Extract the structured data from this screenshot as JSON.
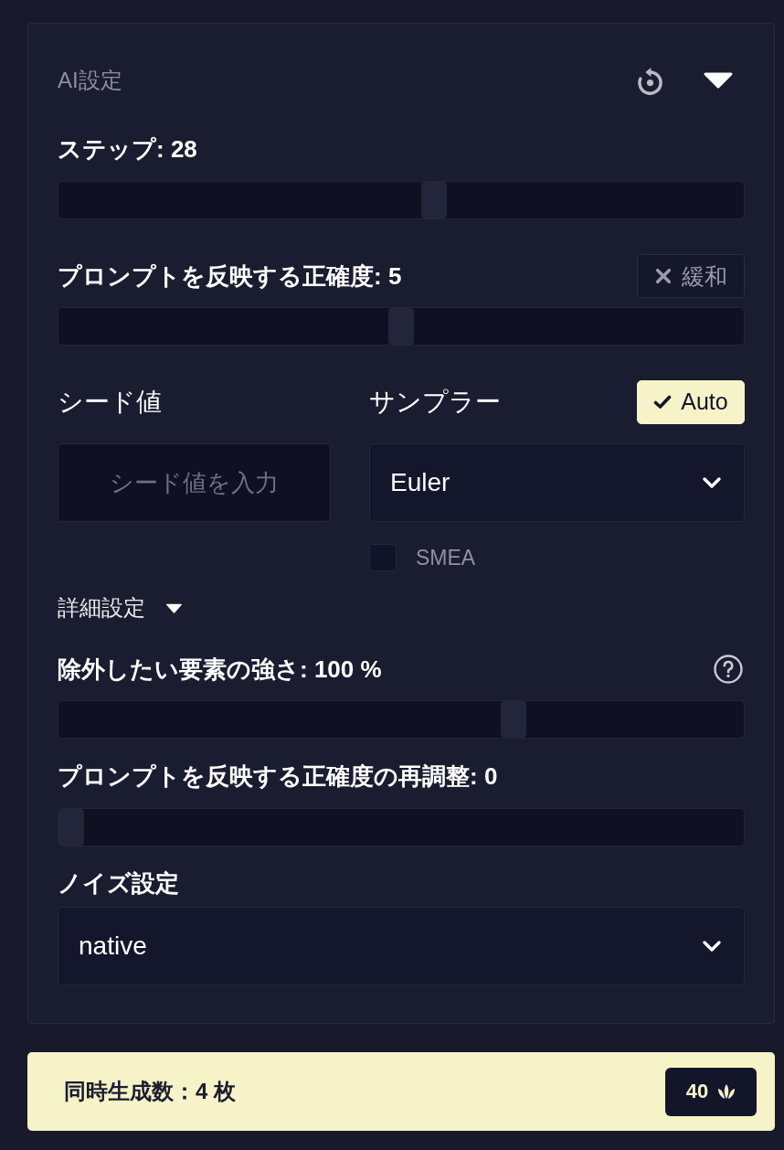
{
  "panel": {
    "title": "AI設定",
    "expanded": true
  },
  "steps": {
    "label": "ステップ: 28",
    "level": 0.55
  },
  "guidance": {
    "label": "プロンプトを反映する正確度: 5",
    "level": 0.5,
    "toggle": {
      "label": "緩和",
      "on": false
    }
  },
  "seed": {
    "label": "シード値",
    "placeholder": "シード値を入力"
  },
  "sampler": {
    "label": "サンプラー",
    "value": "Euler",
    "auto": {
      "label": "Auto",
      "on": true
    },
    "smea": {
      "label": "SMEA",
      "checked": false
    }
  },
  "advanced": {
    "label": "詳細設定",
    "expanded": true,
    "undesired_strength": {
      "label": "除外したい要素の強さ: 100 %",
      "level": 0.67
    },
    "guidance_rescale": {
      "label": "プロンプトを反映する正確度の再調整: 0",
      "level": 0
    },
    "noise": {
      "label": "ノイズ設定",
      "value": "native"
    }
  },
  "batch": {
    "label": "同時生成数：4 枚",
    "cost": "40"
  }
}
